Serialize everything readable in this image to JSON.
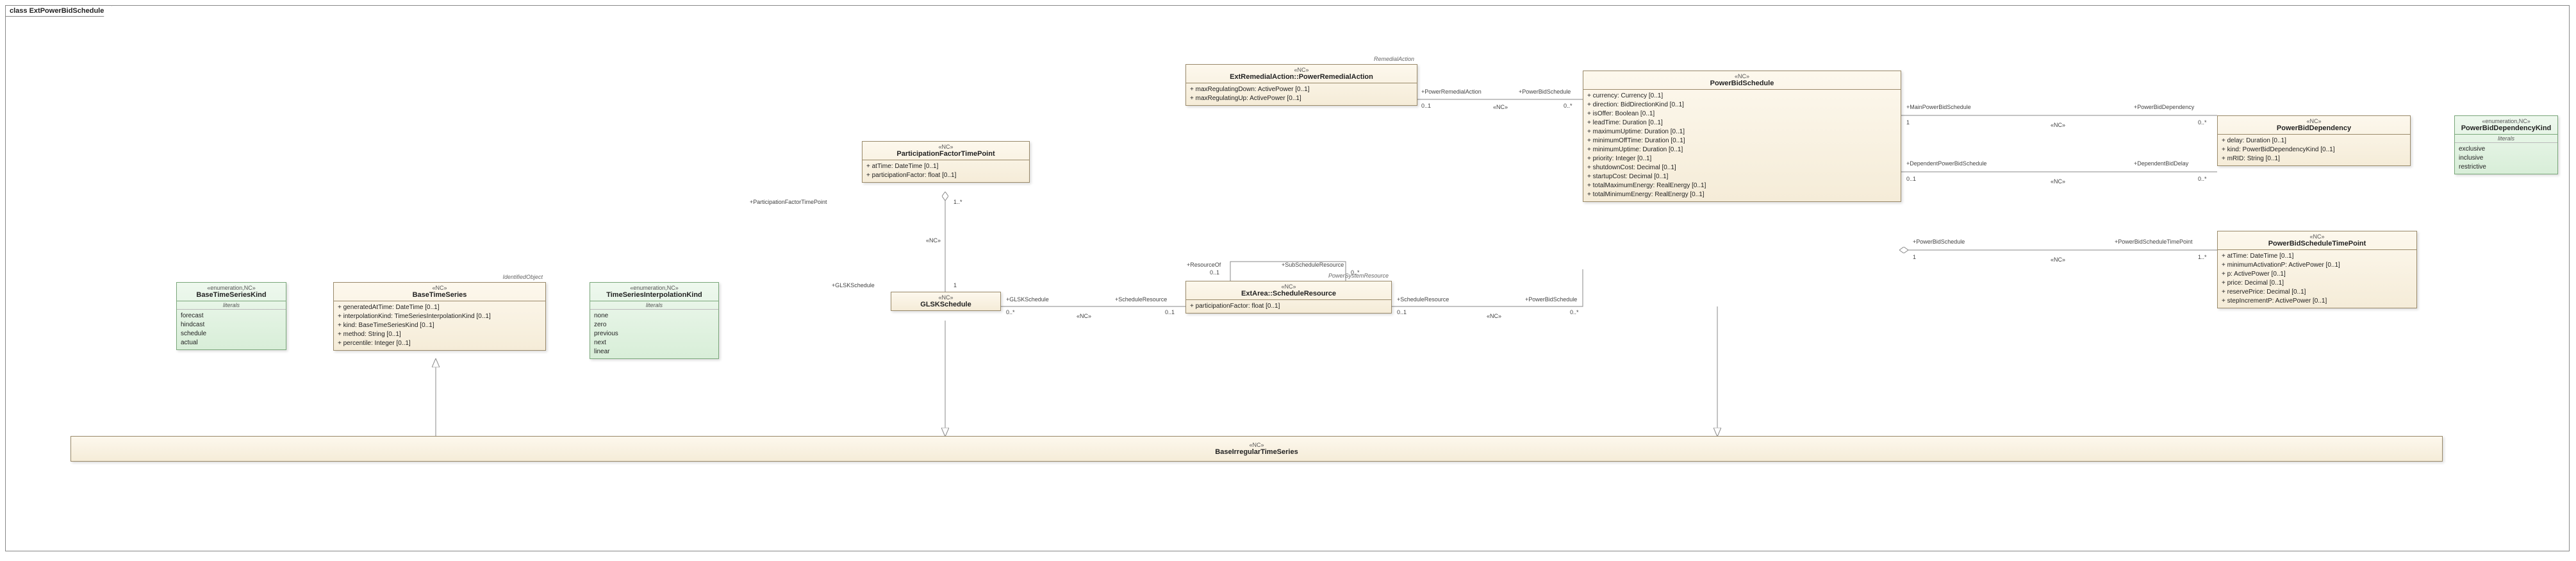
{
  "frame_title": "class ExtPowerBidSchedule",
  "enums": {
    "BaseTimeSeriesKind": {
      "stereo": "«enumeration,NC»",
      "name": "BaseTimeSeriesKind",
      "literals_label": "literals",
      "items": [
        "forecast",
        "hindcast",
        "schedule",
        "actual"
      ]
    },
    "TimeSeriesInterpolationKind": {
      "stereo": "«enumeration,NC»",
      "name": "TimeSeriesInterpolationKind",
      "literals_label": "literals",
      "items": [
        "none",
        "zero",
        "previous",
        "next",
        "linear"
      ]
    },
    "PowerBidDependencyKind": {
      "stereo": "«enumeration,NC»",
      "name": "PowerBidDependencyKind",
      "literals_label": "literals",
      "items": [
        "exclusive",
        "inclusive",
        "restrictive"
      ]
    }
  },
  "classes": {
    "BaseTimeSeries": {
      "tag": "IdentifiedObject",
      "stereo": "«NC»",
      "name": "BaseTimeSeries",
      "attrs": [
        "+   generatedAtTime: DateTime [0..1]",
        "+   interpolationKind: TimeSeriesInterpolationKind [0..1]",
        "+   kind: BaseTimeSeriesKind [0..1]",
        "+   method: String [0..1]",
        "+   percentile: Integer [0..1]"
      ]
    },
    "ParticipationFactorTimePoint": {
      "stereo": "«NC»",
      "name": "ParticipationFactorTimePoint",
      "attrs": [
        "+   atTime: DateTime [0..1]",
        "+   participationFactor: float [0..1]"
      ]
    },
    "GLSKSchedule": {
      "stereo": "«NC»",
      "name": "GLSKSchedule"
    },
    "PowerRemedialAction": {
      "tag": "RemedialAction",
      "stereo": "«NC»",
      "name": "ExtRemedialAction::PowerRemedialAction",
      "attrs": [
        "+   maxRegulatingDown: ActivePower [0..1]",
        "+   maxRegulatingUp: ActivePower [0..1]"
      ]
    },
    "ScheduleResource": {
      "tag": "PowerSystemResource",
      "stereo": "«NC»",
      "name": "ExtArea::ScheduleResource",
      "attrs": [
        "+   participationFactor: float [0..1]"
      ]
    },
    "PowerBidSchedule": {
      "stereo": "«NC»",
      "name": "PowerBidSchedule",
      "attrs": [
        "+   currency: Currency [0..1]",
        "+   direction: BidDirectionKind [0..1]",
        "+   isOffer: Boolean [0..1]",
        "+   leadTime: Duration [0..1]",
        "+   maximumUptime: Duration [0..1]",
        "+   minimumOffTime: Duration [0..1]",
        "+   minimumUptime: Duration [0..1]",
        "+   priority: Integer [0..1]",
        "+   shutdownCost: Decimal [0..1]",
        "+   startupCost: Decimal [0..1]",
        "+   totalMaximumEnergy: RealEnergy [0..1]",
        "+   totalMinimumEnergy: RealEnergy [0..1]"
      ]
    },
    "PowerBidDependency": {
      "stereo": "«NC»",
      "name": "PowerBidDependency",
      "attrs": [
        "+   delay: Duration [0..1]",
        "+   kind: PowerBidDependencyKind [0..1]",
        "+   mRID: String [0..1]"
      ]
    },
    "PowerBidScheduleTimePoint": {
      "stereo": "«NC»",
      "name": "PowerBidScheduleTimePoint",
      "attrs": [
        "+   atTime: DateTime [0..1]",
        "+   minimumActivationP: ActivePower [0..1]",
        "+   p: ActivePower [0..1]",
        "+   price: Decimal [0..1]",
        "+   reservePrice: Decimal [0..1]",
        "+   stepIncrementP: ActivePower [0..1]"
      ]
    },
    "BaseIrregularTimeSeries": {
      "stereo": "«NC»",
      "name": "BaseIrregularTimeSeries"
    }
  },
  "assoc": {
    "pftp_glsk": {
      "role_a": "+ParticipationFactorTimePoint",
      "mult_a": "1..*",
      "stereo": "«NC»",
      "role_b": "+GLSKSchedule",
      "mult_b": "1"
    },
    "glsk_sr": {
      "role_a": "+GLSKSchedule",
      "mult_a": "0..*",
      "stereo": "«NC»",
      "role_b": "+ScheduleResource",
      "mult_b": "0..1"
    },
    "sr_self": {
      "role_a": "+ResourceOf",
      "mult_a": "0..1",
      "role_b": "+SubScheduleResource",
      "mult_b": "0..*"
    },
    "pra_pbs": {
      "role_a": "+PowerRemedialAction",
      "mult_a": "0..1",
      "stereo": "«NC»",
      "role_b": "+PowerBidSchedule",
      "mult_b": "0..*"
    },
    "sr_pbs": {
      "role_a": "+ScheduleResource",
      "mult_a": "0..1",
      "stereo": "«NC»",
      "role_b": "+PowerBidSchedule",
      "mult_b": "0..*"
    },
    "pbs_dep1": {
      "role_a": "+MainPowerBidSchedule",
      "mult_a": "1",
      "stereo": "«NC»",
      "role_b": "+PowerBidDependency",
      "mult_b": "0..*"
    },
    "pbs_dep2": {
      "role_a": "+DependentPowerBidSchedule",
      "mult_a": "0..1",
      "stereo": "«NC»",
      "role_b": "+DependentBidDelay",
      "mult_b": "0..*"
    },
    "pbs_tp": {
      "role_a": "+PowerBidSchedule",
      "mult_a": "1",
      "stereo": "«NC»",
      "role_b": "+PowerBidScheduleTimePoint",
      "mult_b": "1..*"
    }
  }
}
